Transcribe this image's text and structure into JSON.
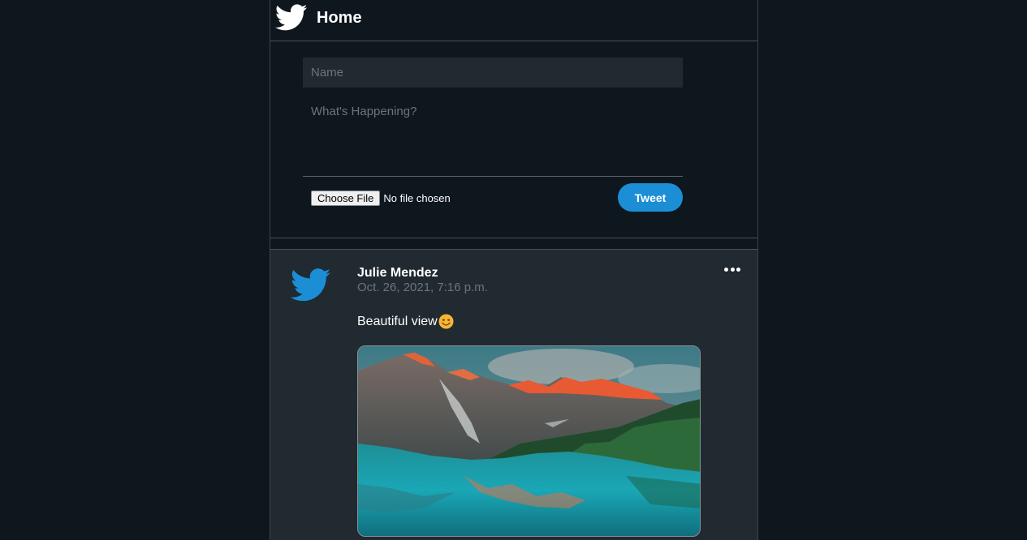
{
  "header": {
    "title": "Home",
    "logo_icon": "twitter-bird-icon"
  },
  "composer": {
    "name_placeholder": "Name",
    "happening_placeholder": "What's Happening?",
    "file_button_label": "Choose File",
    "file_status": "No file chosen",
    "tweet_button_label": "Tweet"
  },
  "post": {
    "author": "Julie Mendez",
    "timestamp": "Oct. 26, 2021, 7:16 p.m.",
    "text": "Beautiful view",
    "emoji_icon": "smiling-face-icon",
    "more_icon": "more-dots-icon",
    "image_subject": "mountain-lake-photo"
  },
  "colors": {
    "background": "#0e171e",
    "post_background": "#202a30",
    "accent": "#1b8ed6",
    "muted_text": "#6f7478"
  }
}
